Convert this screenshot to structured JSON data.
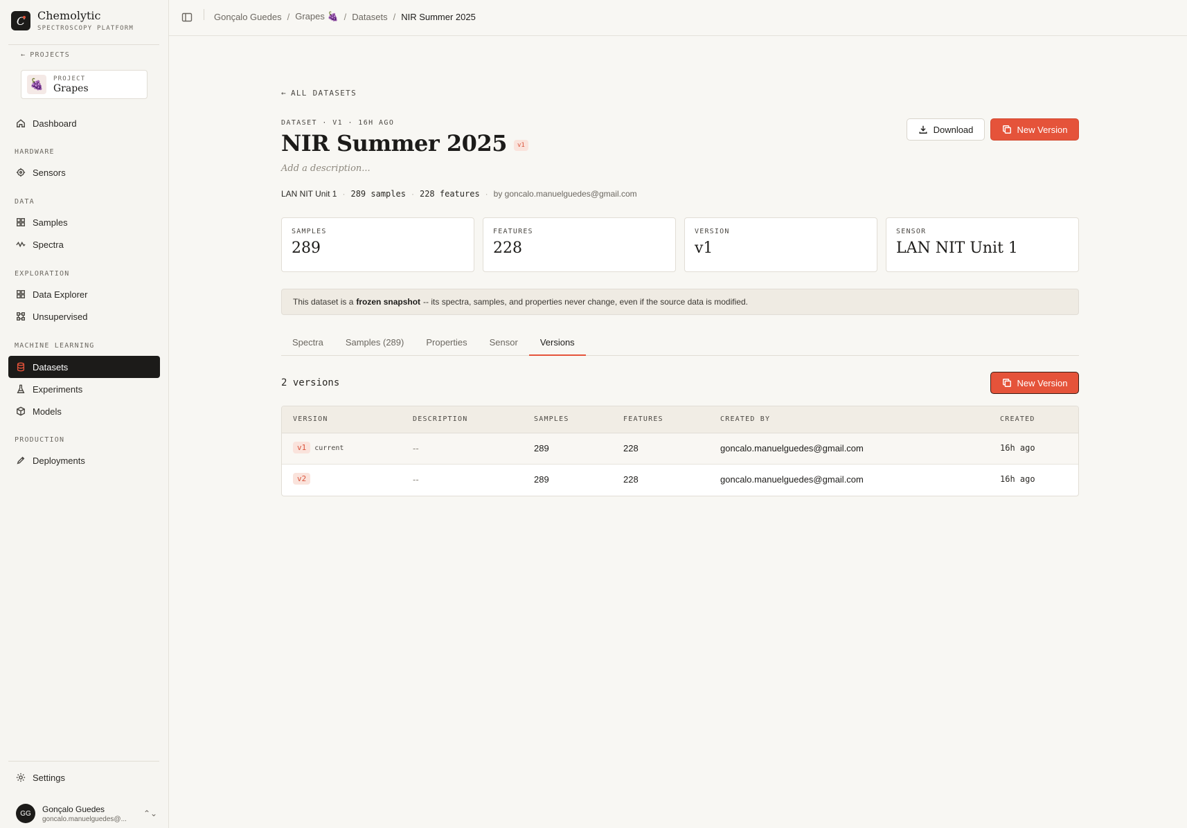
{
  "brand": {
    "name": "Chemolytic",
    "subtitle": "SPECTROSCOPY PLATFORM",
    "logo_letter": "C"
  },
  "sidebar": {
    "back_label": "PROJECTS",
    "project": {
      "label": "PROJECT",
      "name": "Grapes",
      "emoji": "🍇"
    },
    "dashboard": "Dashboard",
    "sections": {
      "hardware": "HARDWARE",
      "data": "DATA",
      "exploration": "EXPLORATION",
      "machine_learning": "MACHINE LEARNING",
      "production": "PRODUCTION"
    },
    "items": {
      "sensors": "Sensors",
      "samples": "Samples",
      "spectra": "Spectra",
      "data_explorer": "Data Explorer",
      "unsupervised": "Unsupervised",
      "datasets": "Datasets",
      "experiments": "Experiments",
      "models": "Models",
      "deployments": "Deployments"
    },
    "settings": "Settings",
    "user": {
      "initials": "GG",
      "name": "Gonçalo Guedes",
      "email": "goncalo.manuelguedes@..."
    }
  },
  "breadcrumb": [
    "Gonçalo Guedes",
    "Grapes 🍇",
    "Datasets",
    "NIR Summer 2025"
  ],
  "dataset": {
    "back_label": "ALL DATASETS",
    "kicker": "DATASET · V1 · 16H AGO",
    "title": "NIR Summer 2025",
    "version_badge": "v1",
    "description_placeholder": "Add a description...",
    "meta": {
      "sensor": "LAN NIT Unit 1",
      "samples": "289 samples",
      "features": "228 features",
      "by": "by goncalo.manuelguedes@gmail.com"
    },
    "actions": {
      "download": "Download",
      "new_version": "New Version"
    }
  },
  "stats": [
    {
      "label": "SAMPLES",
      "value": "289"
    },
    {
      "label": "FEATURES",
      "value": "228"
    },
    {
      "label": "VERSION",
      "value": "v1"
    },
    {
      "label": "SENSOR",
      "value": "LAN NIT Unit 1"
    }
  ],
  "notice": {
    "prefix": "This dataset is a",
    "emphasis": "frozen snapshot",
    "suffix": "-- its spectra, samples, and properties never change, even if the source data is modified."
  },
  "tabs": [
    "Spectra",
    "Samples (289)",
    "Properties",
    "Sensor",
    "Versions"
  ],
  "active_tab": "Versions",
  "versions": {
    "count_label": "2 versions",
    "new_version_label": "New Version",
    "columns": [
      "VERSION",
      "DESCRIPTION",
      "SAMPLES",
      "FEATURES",
      "CREATED BY",
      "CREATED"
    ],
    "rows": [
      {
        "version": "v1",
        "tag": "current",
        "description": "--",
        "samples": "289",
        "features": "228",
        "created_by": "goncalo.manuelguedes@gmail.com",
        "created": "16h ago"
      },
      {
        "version": "v2",
        "tag": "",
        "description": "--",
        "samples": "289",
        "features": "228",
        "created_by": "goncalo.manuelguedes@gmail.com",
        "created": "16h ago"
      }
    ]
  },
  "colors": {
    "accent": "#e5533a",
    "sidebar_active": "#1c1b19",
    "background": "#f8f7f3"
  }
}
